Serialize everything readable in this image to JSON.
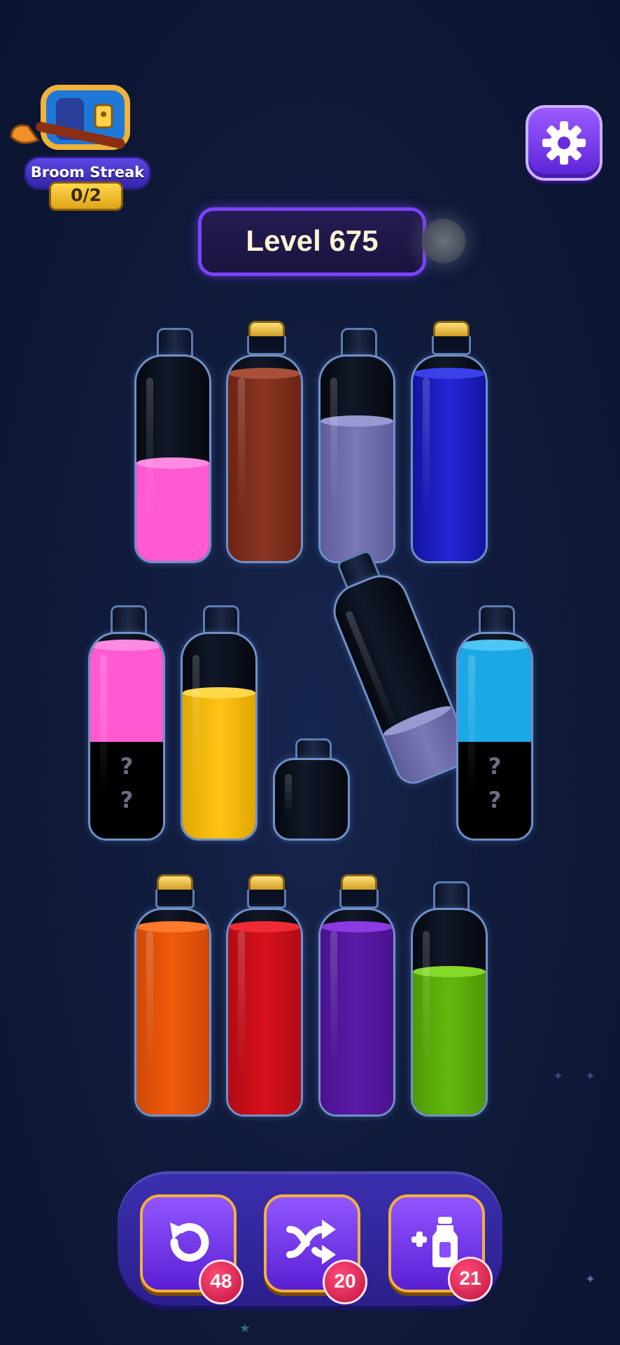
{
  "streak": {
    "label": "Broom Streak",
    "count": "0/2"
  },
  "level": {
    "label": "Level 675"
  },
  "bottles": [
    {
      "id": 1,
      "layers": [
        "#ff5ad2"
      ],
      "hidden": 0
    },
    {
      "id": 2,
      "layers": [
        "#8a3522",
        "#8a3522",
        "#8a3522",
        "#8a3522"
      ],
      "corked": true
    },
    {
      "id": 3,
      "layers": [
        "#7b78b8",
        "#7b78b8"
      ]
    },
    {
      "id": 4,
      "layers": [
        "#1f21c9",
        "#1f21c9",
        "#1f21c9",
        "#1f21c9"
      ],
      "corked": true
    },
    {
      "id": 5,
      "layers": [
        "#ff5ad2"
      ],
      "hidden_marks": [
        "?",
        "?"
      ]
    },
    {
      "id": 6,
      "layers": [
        "#ffc316",
        "#ffc316",
        "#ffc316"
      ]
    },
    {
      "id": 7,
      "layers": [],
      "small": true
    },
    {
      "id": 8,
      "layers": [
        "#7b78b8"
      ],
      "tilted": true
    },
    {
      "id": 9,
      "layers": [
        "#1aa8e6"
      ],
      "hidden_marks": [
        "?",
        "?"
      ]
    },
    {
      "id": 10,
      "layers": [
        "#f05a0c"
      ],
      "corked": true
    },
    {
      "id": 11,
      "layers": [
        "#d8101c"
      ],
      "corked": true
    },
    {
      "id": 12,
      "layers": [
        "#5a1aa8"
      ],
      "corked": true
    },
    {
      "id": 13,
      "layers": [
        "#62b80c"
      ]
    }
  ],
  "tools": {
    "undo": {
      "count": "48"
    },
    "shuffle": {
      "count": "20"
    },
    "add_bottle": {
      "count": "21"
    }
  },
  "hidden_marks": {
    "b5_a": "?",
    "b5_b": "?",
    "b9_a": "?",
    "b9_b": "?"
  }
}
